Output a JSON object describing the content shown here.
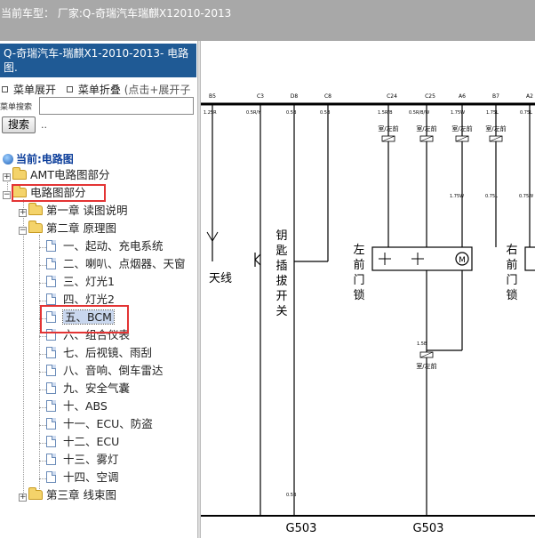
{
  "top_bar": {
    "label": "当前车型： 厂家:Q-奇瑞汽车瑞麒X12010-2013"
  },
  "sidebar": {
    "title": "Q-奇瑞汽车-瑞麒X1-2010-2013- 电路图.",
    "expand_all": "菜单展开",
    "collapse_all": "菜单折叠",
    "collapse_hint": "(点击+展开子",
    "search_label": "菜单搜索",
    "search_placeholder": "",
    "search_button": "搜索",
    "search_hint": "..",
    "tree_header": "当前:电路图",
    "tree": {
      "amt": "AMT电路图部分",
      "circuit": "电路图部分",
      "ch1": "第一章 读图说明",
      "ch2": "第二章 原理图",
      "items": [
        "一、起动、充电系统",
        "二、喇叭、点烟器、天窗",
        "三、灯光1",
        "四、灯光2",
        "五、BCM",
        "六、组合仪表",
        "七、后视镜、雨刮",
        "八、音响、倒车雷达",
        "九、安全气囊",
        "十、ABS",
        "十一、ECU、防盗",
        "十二、ECU",
        "十三、雾灯",
        "十四、空调"
      ],
      "ch3": "第三章 线束图"
    }
  },
  "diagram": {
    "pin_labels": [
      "B5",
      "C3",
      "D8",
      "C8",
      "C24",
      "C25",
      "A6",
      "B7",
      "A2"
    ],
    "wire_labels": [
      "1.25R",
      "0.5R/Y",
      "0.5B",
      "0.5B",
      "1.5R/B",
      "0.5R/B/W",
      "1.75W",
      "1.75L",
      "0.75L",
      "1.75W",
      "0.75L",
      "0.75W",
      "1.5B",
      "0.5B"
    ],
    "connector_labels": [
      "室/左前",
      "室/左前",
      "室/左前",
      "室/左前",
      "室/左前"
    ],
    "component_labels": {
      "antenna": "天线",
      "key_switch": "钥匙插拔开关",
      "left_lock": "左前门锁",
      "right_lock": "右前门锁"
    },
    "ground_labels": [
      "G503",
      "G503"
    ]
  },
  "colors": {
    "top_bar_bg": "#a8a8a8",
    "title_bg": "#1f5a95",
    "highlight": "#e33434",
    "tree_header": "#0b3d9a"
  }
}
